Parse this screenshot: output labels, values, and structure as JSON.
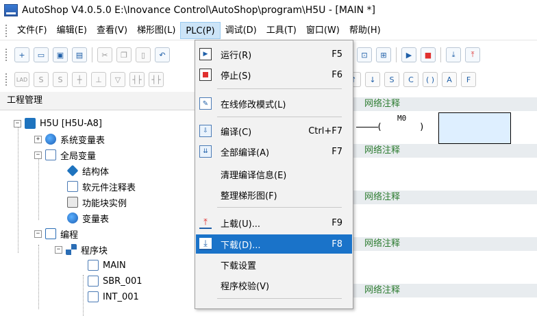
{
  "titlebar": {
    "title": "AutoShop V4.0.5.0  E:\\Inovance Control\\AutoShop\\program\\H5U - [MAIN *]"
  },
  "menubar": {
    "items": [
      "文件(F)",
      "编辑(E)",
      "查看(V)",
      "梯形图(L)",
      "PLC(P)",
      "调试(D)",
      "工具(T)",
      "窗口(W)",
      "帮助(H)"
    ],
    "active_index": 4
  },
  "toolbar2": {
    "lad_label": "LAD",
    "s_label": "S"
  },
  "left_panel": {
    "title": "工程管理",
    "tree": [
      "H5U [H5U-A8]",
      "系统变量表",
      "全局变量",
      "结构体",
      "软元件注释表",
      "功能块实例",
      "变量表",
      "编程",
      "程序块",
      "MAIN",
      "SBR_001",
      "INT_001"
    ]
  },
  "editor": {
    "network_label": "网络注释",
    "contact_label": "M0"
  },
  "plc_menu": {
    "items": [
      {
        "label": "运行(R)",
        "shortcut": "F5",
        "icon": "run-icon"
      },
      {
        "label": "停止(S)",
        "shortcut": "F6",
        "icon": "stop-icon"
      },
      {
        "label": "在线修改模式(L)",
        "shortcut": "",
        "icon": "online-edit-icon"
      },
      {
        "label": "编译(C)",
        "shortcut": "Ctrl+F7",
        "icon": "compile-icon"
      },
      {
        "label": "全部编译(A)",
        "shortcut": "F7",
        "icon": "compile-all-icon"
      },
      {
        "label": "清理编译信息(E)",
        "shortcut": "",
        "icon": ""
      },
      {
        "label": "整理梯形图(F)",
        "shortcut": "",
        "icon": ""
      },
      {
        "label": "上载(U)...",
        "shortcut": "F9",
        "icon": "upload-icon"
      },
      {
        "label": "下载(D)...",
        "shortcut": "F8",
        "icon": "download-icon"
      },
      {
        "label": "下载设置",
        "shortcut": "",
        "icon": ""
      },
      {
        "label": "程序校验(V)",
        "shortcut": "",
        "icon": ""
      }
    ],
    "highlighted_index": 8,
    "colors": {
      "highlight": "#1a73c9"
    }
  }
}
